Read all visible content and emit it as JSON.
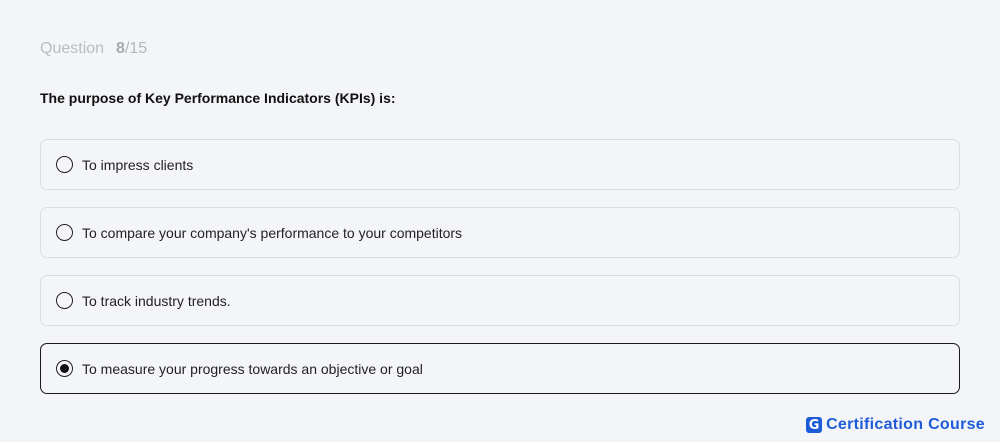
{
  "question": {
    "label": "Question",
    "current": "8",
    "total": "/15",
    "text": "The purpose of Key Performance Indicators (KPIs) is:"
  },
  "options": [
    {
      "label": "To impress clients",
      "selected": false
    },
    {
      "label": "To compare your company's performance to your competitors",
      "selected": false
    },
    {
      "label": "To track industry trends.",
      "selected": false
    },
    {
      "label": "To measure your progress towards an objective or goal",
      "selected": true
    }
  ],
  "brand": {
    "logo_letter": "G",
    "name": "Certification Course",
    "color": "#1e5bd6"
  },
  "icons": {
    "radio": "radio-icon",
    "logo": "brand-logo-icon"
  }
}
